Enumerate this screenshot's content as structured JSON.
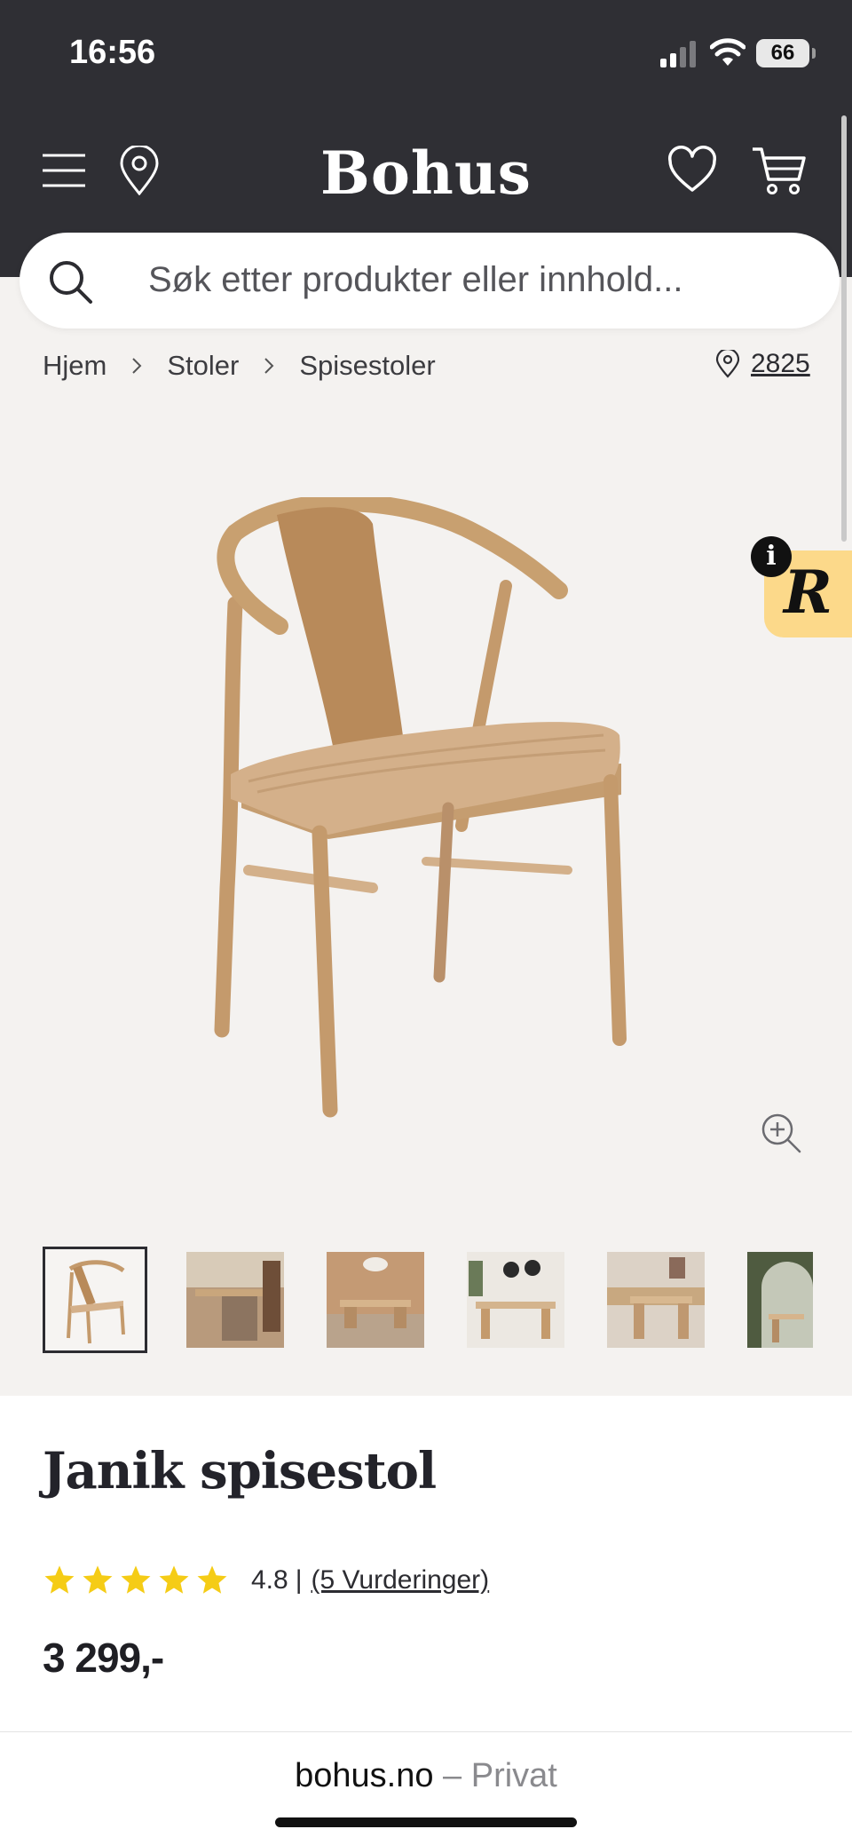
{
  "status_bar": {
    "time": "16:56",
    "battery": "66"
  },
  "header": {
    "logo": "Bohus"
  },
  "search": {
    "placeholder": "Søk etter produkter eller innhold..."
  },
  "breadcrumb": [
    "Hjem",
    "Stoler",
    "Spisestoler"
  ],
  "store": {
    "number": "2825"
  },
  "widget": {
    "info": "i",
    "letter": "R"
  },
  "product": {
    "name": "Janik spisestol",
    "rating_value": 4.8,
    "rating_score": "4.8",
    "rating_separator": "|",
    "rating_count": "(5 Vurderinger)",
    "stars": 5,
    "price": "3 299,-",
    "thumbnails": 6,
    "active_thumbnail": 1
  },
  "browser": {
    "host": "bohus.no",
    "mode": " – Privat"
  },
  "colors": {
    "header_bg": "#2f2f34",
    "star": "#f5cc16",
    "badge": "#fcd98a",
    "page_bg": "#f4f2f0"
  }
}
